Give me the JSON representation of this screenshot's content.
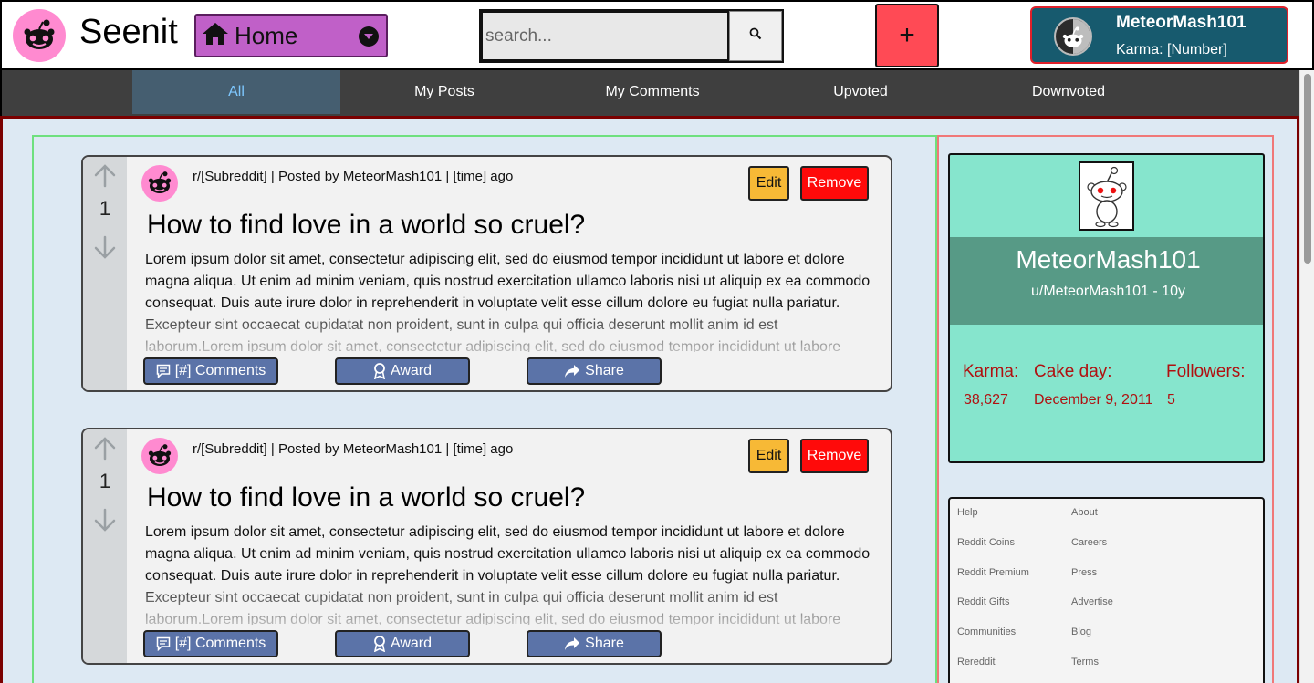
{
  "header": {
    "brand": "Seenit",
    "home_select": "Home",
    "search_placeholder": "search...",
    "add_label": "+",
    "user": {
      "name": "MeteorMash101",
      "karma": "Karma: [Number]"
    }
  },
  "nav": {
    "tabs": [
      "All",
      "My Posts",
      "My Comments",
      "Upvoted",
      "Downvoted"
    ],
    "active": "All"
  },
  "posts": [
    {
      "votes": "1",
      "meta": "r/[Subreddit] | Posted by MeteorMash101 | [time] ago",
      "title": "How to find love in a world so cruel?",
      "body": "Lorem ipsum dolor sit amet, consectetur adipiscing elit, sed do eiusmod tempor incididunt ut labore et dolore magna aliqua. Ut enim ad minim veniam, quis nostrud exercitation ullamco laboris nisi ut aliquip ex ea commodo consequat. Duis aute irure dolor in reprehenderit in voluptate velit esse cillum dolore eu fugiat nulla pariatur. Excepteur sint occaecat cupidatat non proident, sunt in culpa qui officia deserunt mollit anim id est laborum.Lorem ipsum dolor sit amet, consectetur adipiscing elit, sed do eiusmod tempor incididunt ut labore",
      "edit_label": "Edit",
      "remove_label": "Remove",
      "comments_label": "[#] Comments",
      "award_label": "Award",
      "share_label": "Share"
    },
    {
      "votes": "1",
      "meta": "r/[Subreddit] | Posted by MeteorMash101 | [time] ago",
      "title": "How to find love in a world so cruel?",
      "body": "Lorem ipsum dolor sit amet, consectetur adipiscing elit, sed do eiusmod tempor incididunt ut labore et dolore magna aliqua. Ut enim ad minim veniam, quis nostrud exercitation ullamco laboris nisi ut aliquip ex ea commodo consequat. Duis aute irure dolor in reprehenderit in voluptate velit esse cillum dolore eu fugiat nulla pariatur. Excepteur sint occaecat cupidatat non proident, sunt in culpa qui officia deserunt mollit anim id est laborum.Lorem ipsum dolor sit amet, consectetur adipiscing elit, sed do eiusmod tempor incididunt ut labore",
      "edit_label": "Edit",
      "remove_label": "Remove",
      "comments_label": "[#] Comments",
      "award_label": "Award",
      "share_label": "Share"
    }
  ],
  "profile": {
    "name": "MeteorMash101",
    "handle": "u/MeteorMash101 - 10y",
    "karma_label": "Karma:",
    "karma_value": "38,627",
    "cakeday_label": "Cake day:",
    "cakeday_value": "December 9, 2011",
    "followers_label": "Followers:",
    "followers_value": "5"
  },
  "footer_links": {
    "left": [
      "Help",
      "Reddit Coins",
      "Reddit Premium",
      "Reddit Gifts",
      "Communities",
      "Rereddit"
    ],
    "right": [
      "About",
      "Careers",
      "Press",
      "Advertise",
      "Blog",
      "Terms"
    ]
  },
  "colors": {
    "accent_pink": "#ff8ad0",
    "home_purple": "#c060c8",
    "add_red": "#ff4a55",
    "user_teal": "#175a6e",
    "nav_active": "#455e70",
    "profile_mint": "#86e5cd",
    "profile_band": "#579a86",
    "stat_red": "#b01010",
    "edit_yellow": "#f7b936",
    "remove_red": "#ff0a0a",
    "action_blue": "#5b73a8"
  },
  "icons": [
    "snoo-logo-icon",
    "home-icon",
    "chevron-down-icon",
    "search-icon",
    "plus-icon",
    "snoo-avatar-icon",
    "arrow-up-icon",
    "arrow-down-icon",
    "comment-icon",
    "award-icon",
    "share-icon"
  ]
}
